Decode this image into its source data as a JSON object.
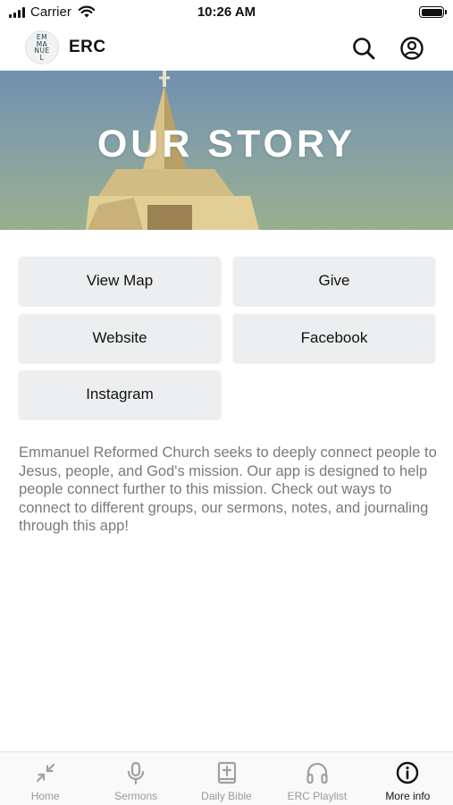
{
  "status_bar": {
    "carrier": "Carrier",
    "time": "10:26 AM"
  },
  "header": {
    "logo_text": "EMMANUEL",
    "title": "ERC",
    "icons": [
      "search-icon",
      "account-icon"
    ]
  },
  "hero": {
    "title": "OUR STORY"
  },
  "buttons": {
    "view_map": "View Map",
    "give": "Give",
    "website": "Website",
    "facebook": "Facebook",
    "instagram": "Instagram"
  },
  "description": "Emmanuel Reformed Church seeks to deeply connect people to Jesus, people, and God's mission. Our app is designed to help people connect further to this mission. Check out ways to connect to different groups, our sermons, notes, and journaling through this app!",
  "tabs": [
    {
      "label": "Home",
      "icon": "collapse-arrows-icon",
      "active": false
    },
    {
      "label": "Sermons",
      "icon": "microphone-icon",
      "active": false
    },
    {
      "label": "Daily Bible",
      "icon": "bible-icon",
      "active": false
    },
    {
      "label": "ERC Playlist",
      "icon": "headphones-icon",
      "active": false
    },
    {
      "label": "More info",
      "icon": "info-icon",
      "active": true
    }
  ],
  "colors": {
    "button_bg": "#eceeef",
    "active_tab": "#111111",
    "inactive_tab": "#9a9a9a",
    "description_text": "#7a7a7a"
  }
}
